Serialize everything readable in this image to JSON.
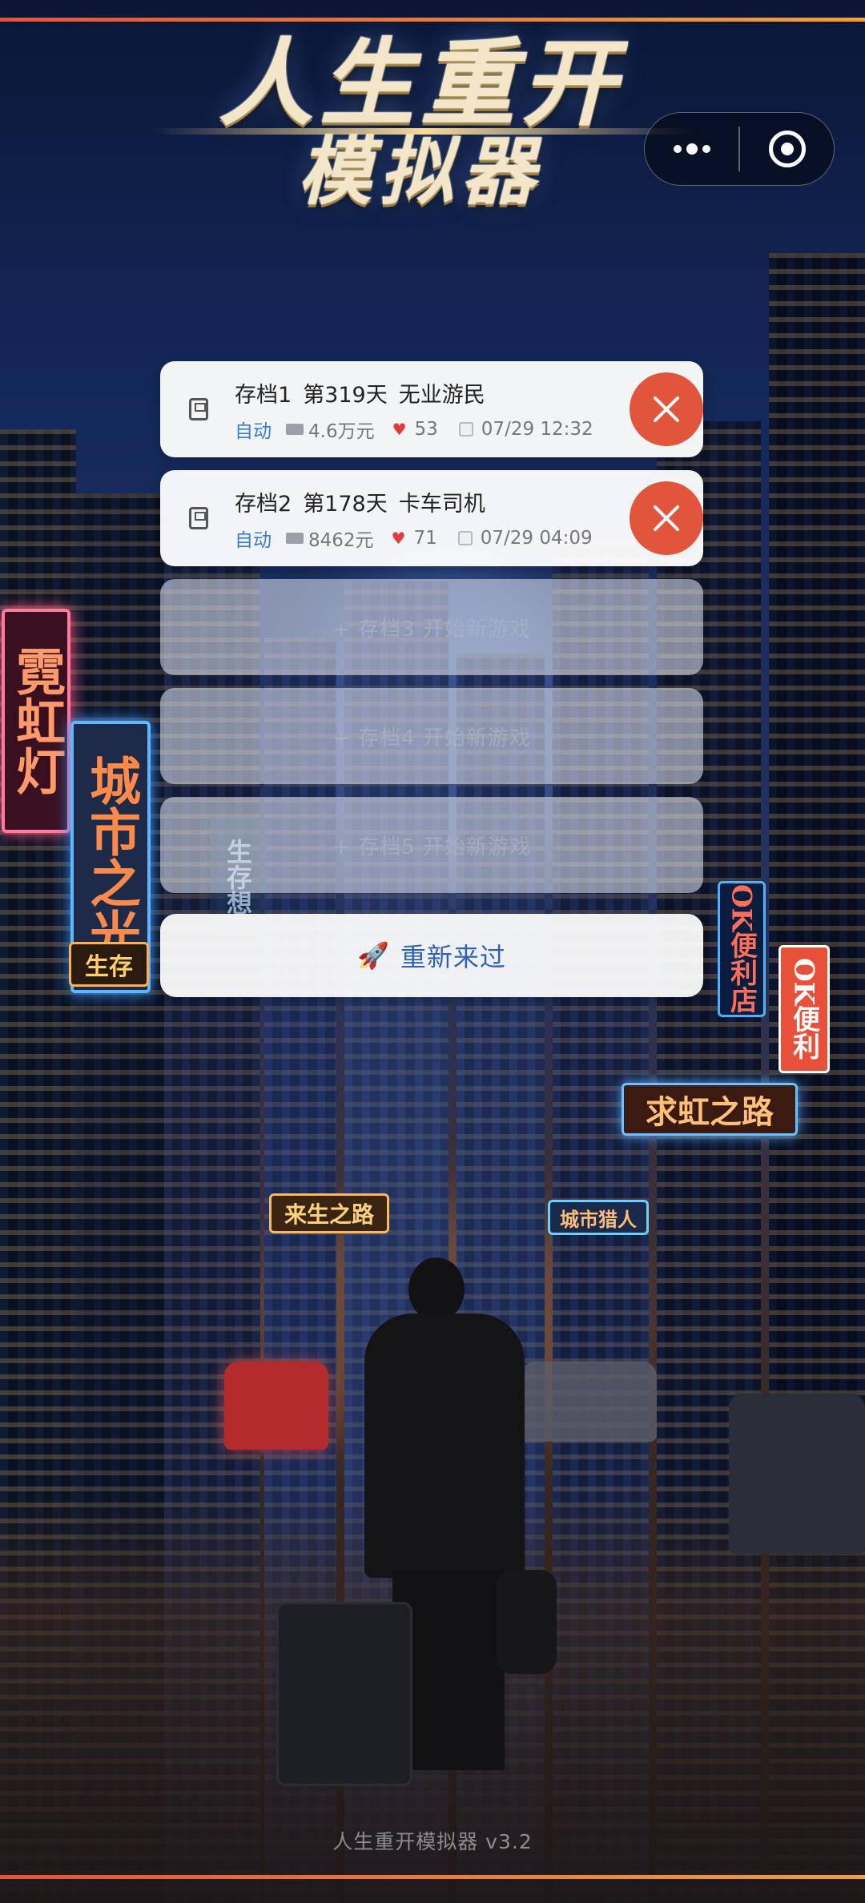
{
  "app": {
    "title_line1": "人生重开",
    "title_line2": "模拟器",
    "version": "人生重开模拟器 v3.2"
  },
  "capsule": {
    "menu_icon": "more-dots-icon",
    "close_icon": "target-circle-icon"
  },
  "slots": [
    {
      "name": "存档1",
      "day": "第319天",
      "job": "无业游民",
      "mode": "自动",
      "money": "4.6万元",
      "health": "53",
      "datetime": "07/29 12:32"
    },
    {
      "name": "存档2",
      "day": "第178天",
      "job": "卡车司机",
      "mode": "自动",
      "money": "8462元",
      "health": "71",
      "datetime": "07/29 04:09"
    }
  ],
  "empty_slots": [
    "+ 存档3 开始新游戏",
    "+ 存档4 开始新游戏",
    "+ 存档5 开始新游戏"
  ],
  "restart": {
    "icon": "🚀",
    "label": "重新来过"
  },
  "background": {
    "signs": [
      "霓虹灯",
      "城市之光",
      "生存",
      "OK便利店",
      "OK便利",
      "求虹之路",
      "来生之路",
      "城市猎人",
      "生存想"
    ]
  },
  "colors": {
    "accent_line": "#e2543a",
    "delete_button": "#e2553d",
    "auto_label": "#3a7bd5",
    "restart_text": "#2e63b8",
    "heart": "#e23b3b"
  }
}
